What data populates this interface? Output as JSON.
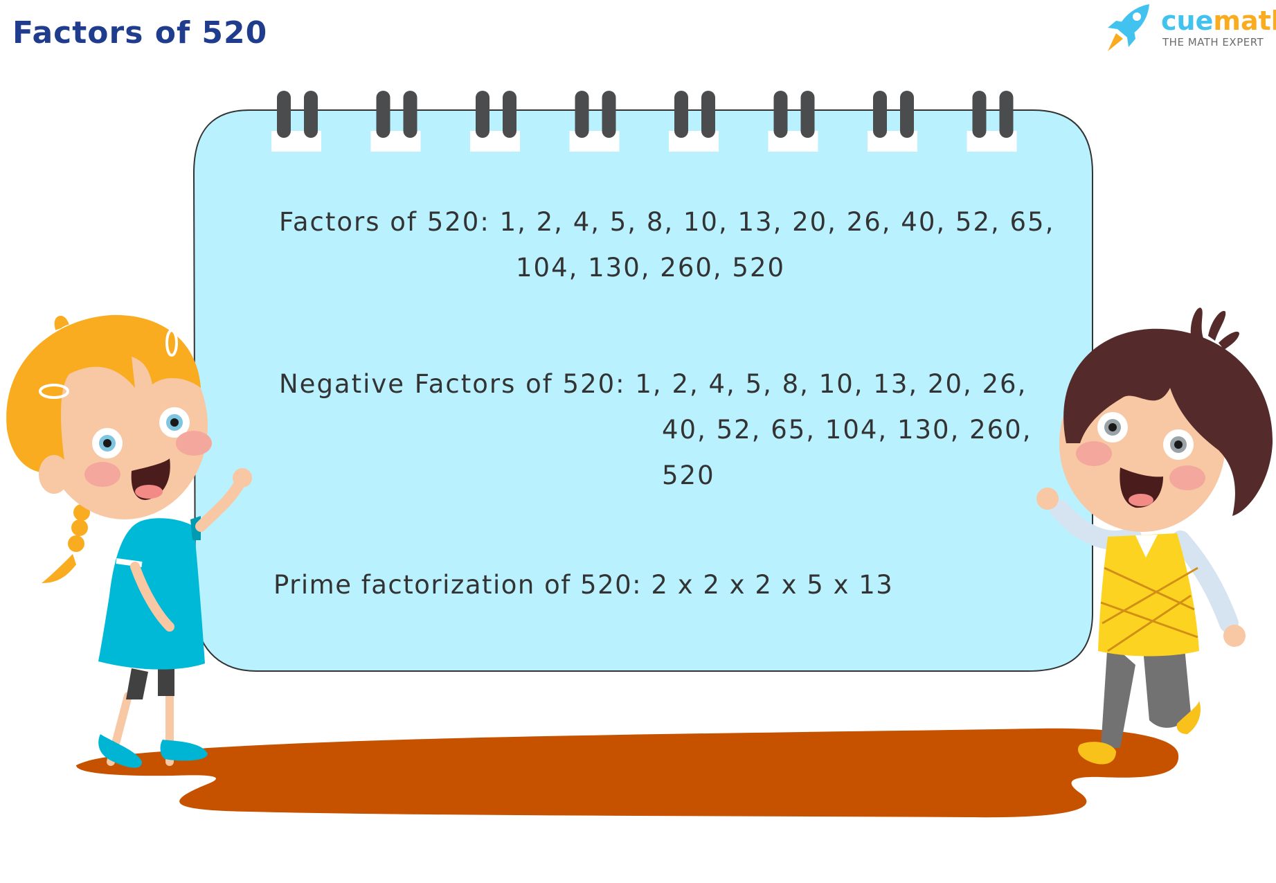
{
  "header": {
    "title": "Factors of 520"
  },
  "brand": {
    "name_part1": "cue",
    "name_part2": "math",
    "tagline": "THE MATH EXPERT",
    "icon": "rocket-icon",
    "colors": {
      "blue": "#42c2ef",
      "orange": "#f9ac1f"
    }
  },
  "notebook": {
    "background": "#b9f1fe",
    "rings": 8,
    "sections": {
      "factors": {
        "label": "Factors of 520:",
        "line1": "1, 2, 4, 5, 8, 10, 13, 20, 26, 40, 52, 65,",
        "line2": "104, 130, 260, 520"
      },
      "negative_factors": {
        "label": "Negative Factors of 520:",
        "line1": "1, 2, 4, 5, 8, 10, 13, 20, 26,",
        "line2": "40, 52, 65, 104, 130, 260,",
        "line3": "520"
      },
      "prime_factorization": {
        "label": "Prime factorization of 520:",
        "value": "2 x 2 x 2 x 5 x 13"
      }
    }
  },
  "illustration": {
    "left_character": "girl-waving",
    "right_character": "boy-waving",
    "ground": "puddle-shadow"
  }
}
